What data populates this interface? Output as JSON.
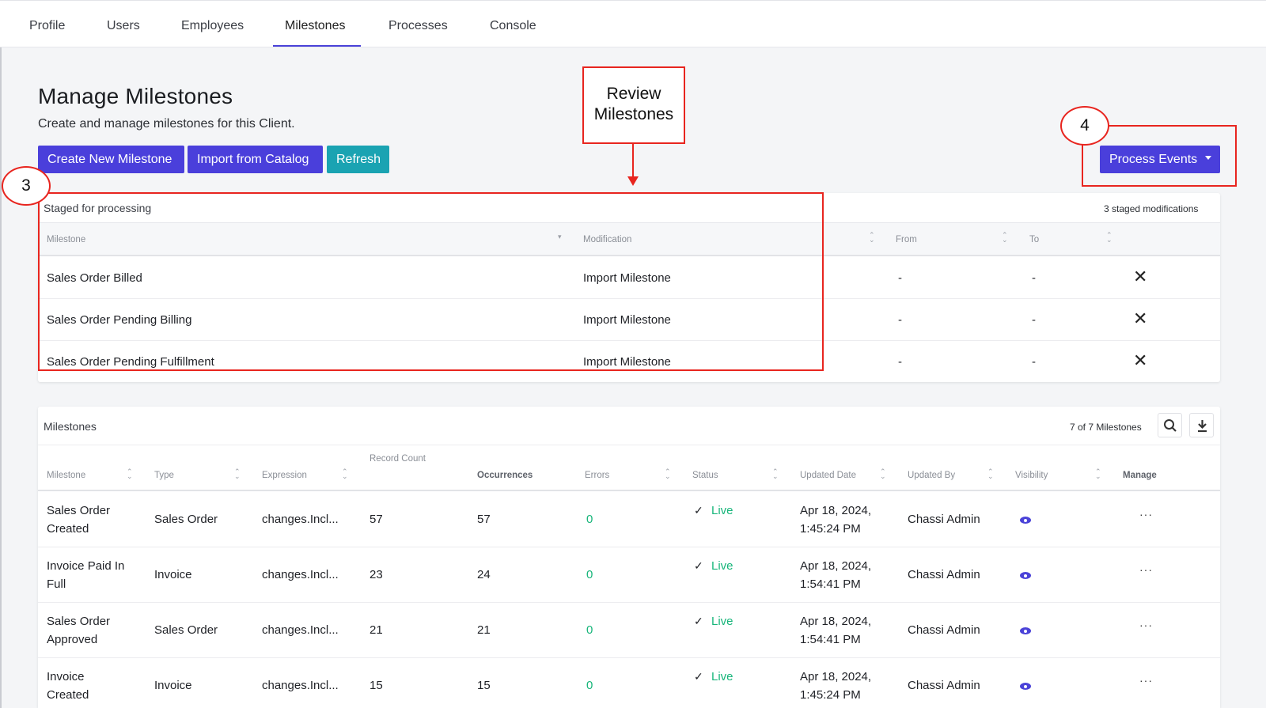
{
  "nav": {
    "tabs": [
      {
        "label": "Profile"
      },
      {
        "label": "Users"
      },
      {
        "label": "Employees"
      },
      {
        "label": "Milestones"
      },
      {
        "label": "Processes"
      },
      {
        "label": "Console"
      }
    ],
    "active_tab": "Milestones"
  },
  "header": {
    "title": "Manage Milestones",
    "subtitle": "Create and manage milestones for this Client."
  },
  "toolbar": {
    "create_label": "Create New Milestone",
    "import_label": "Import from Catalog",
    "refresh_label": "Refresh",
    "process_label": "Process Events"
  },
  "staged": {
    "title": "Staged for processing",
    "count_text": "3 staged modifications",
    "columns": [
      "Milestone",
      "Modification",
      "From",
      "To"
    ],
    "rows": [
      {
        "milestone": "Sales Order Billed",
        "modification": "Import Milestone",
        "from": "-",
        "to": "-"
      },
      {
        "milestone": "Sales Order Pending Billing",
        "modification": "Import Milestone",
        "from": "-",
        "to": "-"
      },
      {
        "milestone": "Sales Order Pending Fulfillment",
        "modification": "Import Milestone",
        "from": "-",
        "to": "-"
      }
    ]
  },
  "milestones": {
    "title": "Milestones",
    "count_text": "7 of 7 Milestones",
    "columns": [
      "Milestone",
      "Type",
      "Expression",
      "Record Count",
      "Occurrences",
      "Errors",
      "Status",
      "Updated Date",
      "Updated By",
      "Visibility",
      "Manage"
    ],
    "rows": [
      {
        "milestone": "Sales Order Created",
        "type": "Sales Order",
        "expression": "changes.Incl...",
        "record_count": "57",
        "occurrences": "57",
        "errors": "0",
        "status": "Live",
        "updated_date": "Apr 18, 2024, 1:45:24 PM",
        "updated_by": "Chassi Admin"
      },
      {
        "milestone": "Invoice Paid In Full",
        "type": "Invoice",
        "expression": "changes.Incl...",
        "record_count": "23",
        "occurrences": "24",
        "errors": "0",
        "status": "Live",
        "updated_date": "Apr 18, 2024, 1:54:41 PM",
        "updated_by": "Chassi Admin"
      },
      {
        "milestone": "Sales Order Approved",
        "type": "Sales Order",
        "expression": "changes.Incl...",
        "record_count": "21",
        "occurrences": "21",
        "errors": "0",
        "status": "Live",
        "updated_date": "Apr 18, 2024, 1:54:41 PM",
        "updated_by": "Chassi Admin"
      },
      {
        "milestone": "Invoice Created",
        "type": "Invoice",
        "expression": "changes.Incl...",
        "record_count": "15",
        "occurrences": "15",
        "errors": "0",
        "status": "Live",
        "updated_date": "Apr 18, 2024, 1:45:24 PM",
        "updated_by": "Chassi Admin"
      }
    ]
  },
  "annotations": {
    "review_label_line1": "Review",
    "review_label_line2": "Milestones",
    "step3": "3",
    "step4": "4"
  },
  "icons": {
    "remove": "close-icon",
    "search": "search-icon",
    "download": "download-icon",
    "visibility": "eye-icon",
    "manage": "more-icon",
    "status": "check-icon"
  },
  "colors": {
    "primary": "#4a3fdb",
    "teal": "#1aa3b2",
    "live": "#17b57a",
    "annotation": "#e8251f"
  }
}
